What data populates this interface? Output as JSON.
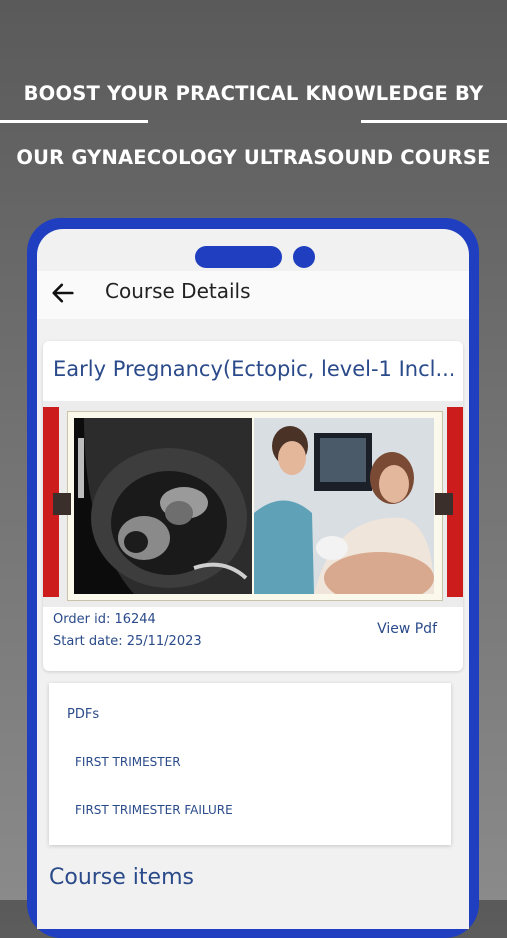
{
  "promo": {
    "line1": "BOOST YOUR PRACTICAL KNOWLEDGE BY",
    "line2": "OUR GYNAECOLOGY ULTRASOUND COURSE"
  },
  "appbar": {
    "title": "Course Details",
    "back_icon": "arrow-left-icon"
  },
  "course": {
    "title": "Early Pregnancy(Ectopic, level-1 Incl...",
    "order_id": "Order id: 16244",
    "start_date": "Start date: 25/11/2023",
    "view_pdf_label": "View Pdf"
  },
  "pdfs": {
    "section_label": "PDFs",
    "items": [
      {
        "label": "FIRST TRIMESTER"
      },
      {
        "label": "FIRST TRIMESTER FAILURE"
      }
    ]
  },
  "course_items_heading": "Course items",
  "colors": {
    "phone_frame": "#1f3fc0",
    "accent_text": "#2a4a8a",
    "banner_red": "#cc1c1c"
  }
}
